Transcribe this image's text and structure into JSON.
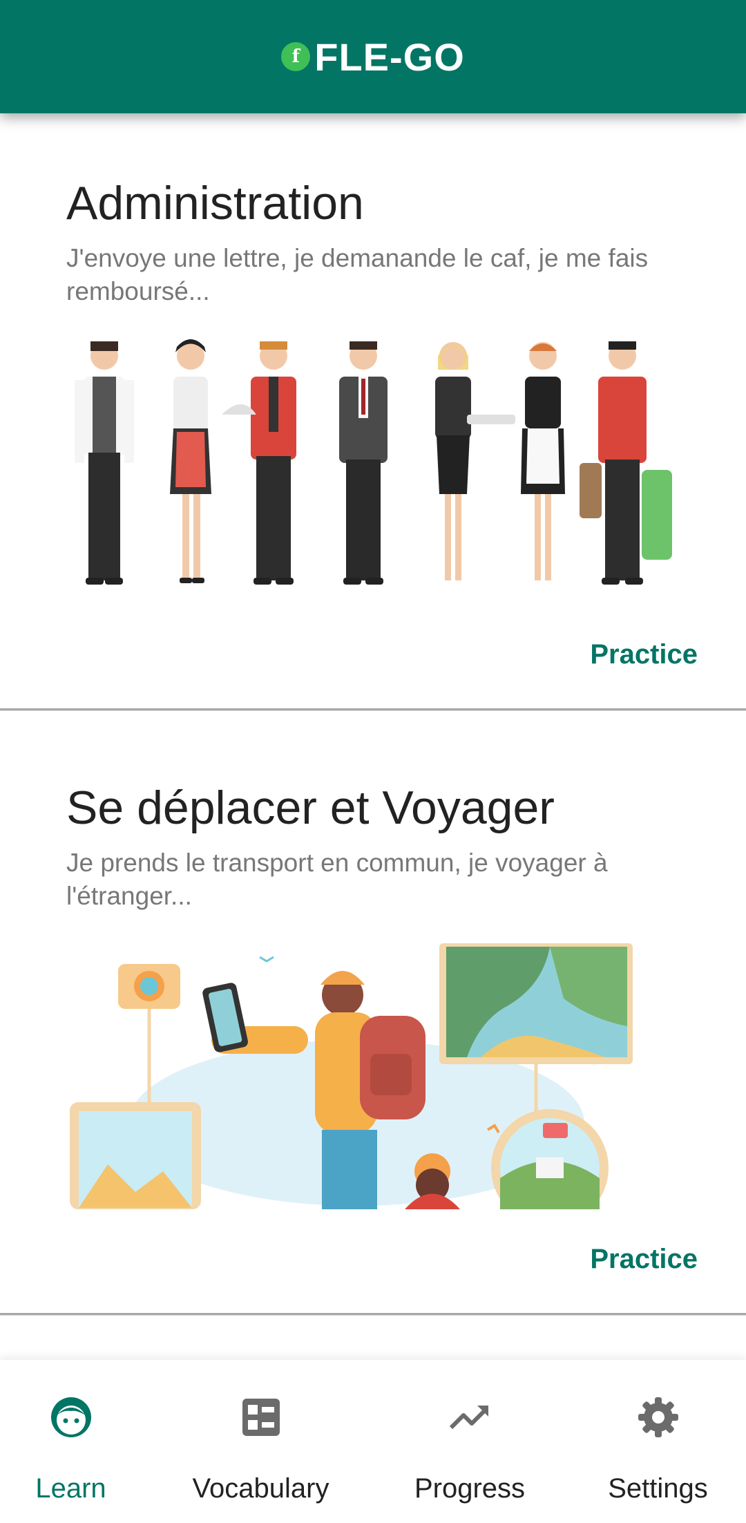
{
  "app": {
    "title": "FLE-GO",
    "logo_letter": "f",
    "brand_color": "#037565"
  },
  "cards": [
    {
      "title": "Administration",
      "description": "J'envoye une lettre, je demanande le caf, je me fais remboursé...",
      "action": "Practice",
      "image": "hotel-staff-illustration"
    },
    {
      "title": "Se déplacer et Voyager",
      "description": "Je prends le transport en commun, je voyager à l'étranger...",
      "action": "Practice",
      "image": "traveler-map-illustration"
    }
  ],
  "nav": [
    {
      "label": "Learn",
      "icon": "face-icon",
      "active": true
    },
    {
      "label": "Vocabulary",
      "icon": "list-icon",
      "active": false
    },
    {
      "label": "Progress",
      "icon": "trending-up-icon",
      "active": false
    },
    {
      "label": "Settings",
      "icon": "gear-icon",
      "active": false
    }
  ]
}
